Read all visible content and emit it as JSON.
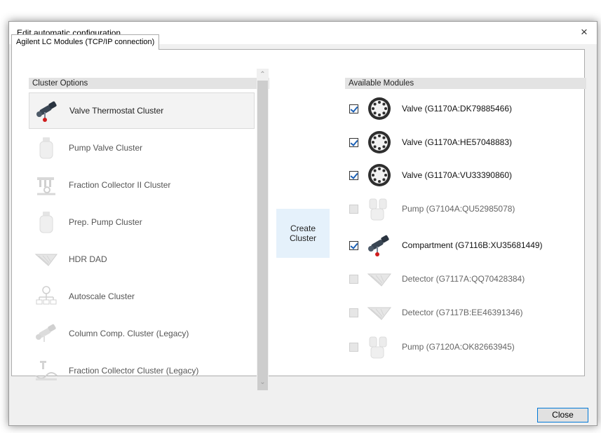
{
  "dialog": {
    "title": "Edit automatic configuration",
    "close_glyph": "×"
  },
  "tab": {
    "label": "Agilent LC Modules (TCP/IP connection)"
  },
  "cluster_options": {
    "header": "Cluster Options",
    "items": [
      {
        "label": "Valve Thermostat Cluster",
        "icon": "valve-thermostat-icon",
        "selected": true
      },
      {
        "label": "Pump Valve Cluster",
        "icon": "pump-icon"
      },
      {
        "label": "Fraction Collector II Cluster",
        "icon": "fraction-collector-icon"
      },
      {
        "label": "Prep. Pump Cluster",
        "icon": "pump-icon"
      },
      {
        "label": "HDR DAD",
        "icon": "detector-icon"
      },
      {
        "label": "Autoscale Cluster",
        "icon": "autoscale-icon"
      },
      {
        "label": "Column Comp. Cluster (Legacy)",
        "icon": "column-comp-icon"
      },
      {
        "label": "Fraction Collector Cluster (Legacy)",
        "icon": "fraction-collector-icon"
      }
    ]
  },
  "create_button": {
    "label": "Create\nCluster"
  },
  "available_modules": {
    "header": "Available Modules",
    "items": [
      {
        "label": "Valve (G1170A:DK79885466)",
        "checked": true,
        "icon": "valve-icon"
      },
      {
        "label": "Valve (G1170A:HE57048883)",
        "checked": true,
        "icon": "valve-icon"
      },
      {
        "label": "Valve (G1170A:VU33390860)",
        "checked": true,
        "icon": "valve-icon"
      },
      {
        "label": "Pump (G7104A:QU52985078)",
        "checked": false,
        "icon": "pump-icon"
      },
      {
        "label": "Compartment (G7116B:XU35681449)",
        "checked": true,
        "icon": "column-comp-icon"
      },
      {
        "label": "Detector (G7117A:QQ70428384)",
        "checked": false,
        "icon": "detector-icon"
      },
      {
        "label": "Detector (G7117B:EE46391346)",
        "checked": false,
        "icon": "detector-icon"
      },
      {
        "label": "Pump (G7120A:OK82663945)",
        "checked": false,
        "icon": "pump-icon"
      }
    ]
  },
  "footer": {
    "close_label": "Close"
  },
  "colors": {
    "accent": "#0078d7",
    "checkmark": "#1a5fb4",
    "create_bg": "#e5f1fb"
  }
}
